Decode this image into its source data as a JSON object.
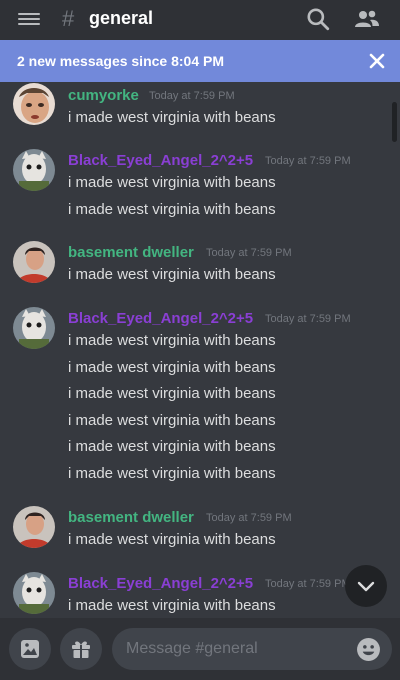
{
  "header": {
    "hash": "#",
    "channel": "general"
  },
  "banner": {
    "text": "2 new messages since 8:04 PM"
  },
  "messages": [
    {
      "author": "cumyorke",
      "time": "Today at 7:59 PM",
      "lines": [
        "i made west virginia with beans"
      ]
    },
    {
      "author": "Black_Eyed_Angel_2^2+5",
      "time": "Today at 7:59 PM",
      "lines": [
        "i made west virginia with beans",
        "i made west virginia with beans"
      ]
    },
    {
      "author": "basement dweller",
      "time": "Today at 7:59 PM",
      "lines": [
        "i made west virginia with beans"
      ]
    },
    {
      "author": "Black_Eyed_Angel_2^2+5",
      "time": "Today at 7:59 PM",
      "lines": [
        "i made west virginia with beans",
        "i made west virginia with beans",
        "i made west virginia with beans",
        "i made west virginia with beans",
        "i made west virginia with beans",
        "i made west virginia with beans"
      ]
    },
    {
      "author": "basement dweller",
      "time": "Today at 7:59 PM",
      "lines": [
        "i made west virginia with beans"
      ]
    },
    {
      "author": "Black_Eyed_Angel_2^2+5",
      "time": "Today at 7:59 PM",
      "lines": [
        "i made west virginia with beans"
      ]
    }
  ],
  "composer": {
    "placeholder": "Message #general"
  },
  "colors": {
    "background": "#36393f",
    "header": "#2f3136",
    "banner": "#7289da",
    "green_author": "#43b581",
    "purple_author": "#8a3fd4",
    "timestamp": "#72767d"
  },
  "icons": [
    "hamburger-icon",
    "search-icon",
    "people-icon",
    "close-icon",
    "chevron-down-icon",
    "image-icon",
    "gift-icon",
    "emoji-icon"
  ]
}
